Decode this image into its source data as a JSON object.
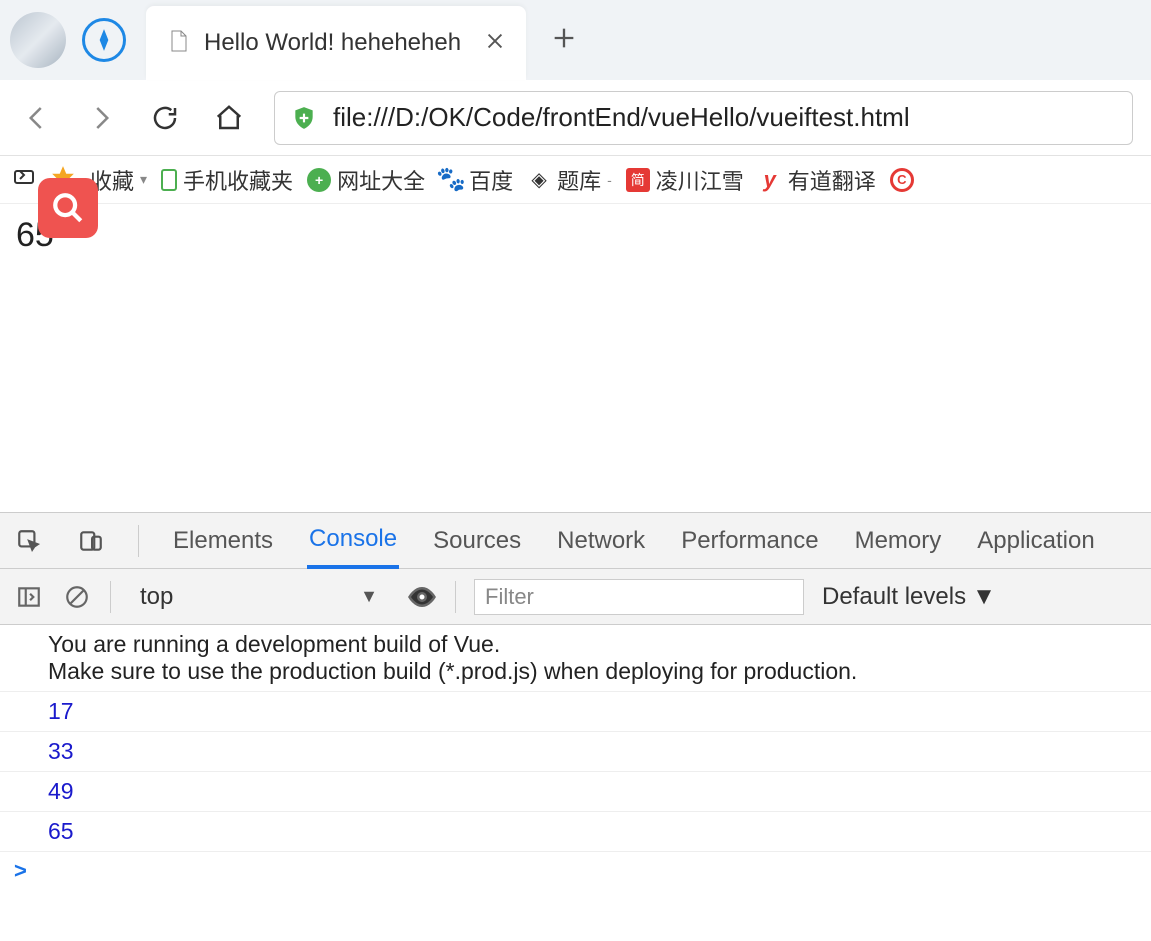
{
  "tab": {
    "title": "Hello World! heheheheh"
  },
  "url": "file:///D:/OK/Code/frontEnd/vueHello/vueiftest.html",
  "bookmarks": {
    "fav": "收藏",
    "mobile": "手机收藏夹",
    "wangzhi": "网址大全",
    "baidu": "百度",
    "tiku": "题库",
    "lingchuan": "凌川江雪",
    "youdao": "有道翻译"
  },
  "page": {
    "value": "65"
  },
  "devtools": {
    "tabs": {
      "elements": "Elements",
      "console": "Console",
      "sources": "Sources",
      "network": "Network",
      "performance": "Performance",
      "memory": "Memory",
      "application": "Application"
    },
    "context": "top",
    "filter_placeholder": "Filter",
    "levels": "Default levels",
    "logs": {
      "warn": "You are running a development build of Vue.\nMake sure to use the production build (*.prod.js) when deploying for production.",
      "n1": "17",
      "n2": "33",
      "n3": "49",
      "n4": "65"
    },
    "prompt": ">"
  }
}
